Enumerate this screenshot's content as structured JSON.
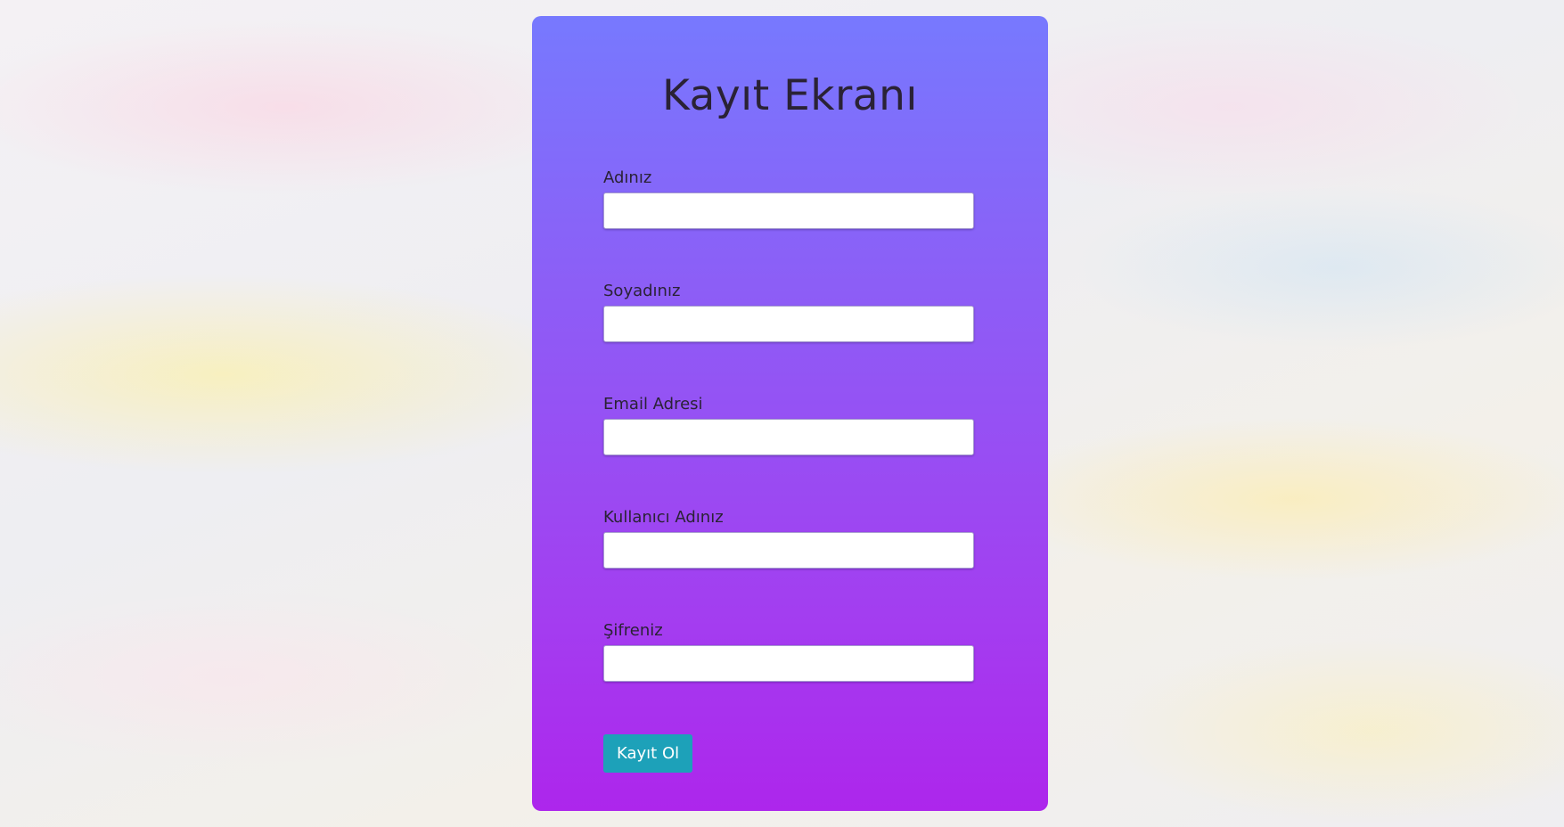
{
  "form": {
    "title": "Kayıt Ekranı",
    "fields": [
      {
        "label": "Adınız",
        "value": ""
      },
      {
        "label": "Soyadınız",
        "value": ""
      },
      {
        "label": "Email Adresi",
        "value": ""
      },
      {
        "label": "Kullanıcı Adınız",
        "value": ""
      },
      {
        "label": "Şifreniz",
        "value": ""
      }
    ],
    "submit_label": "Kayıt Ol"
  },
  "colors": {
    "card_gradient_top": "#7779fe",
    "card_gradient_bottom": "#ad26ec",
    "button": "#1da1b9",
    "text": "#2a2235"
  }
}
